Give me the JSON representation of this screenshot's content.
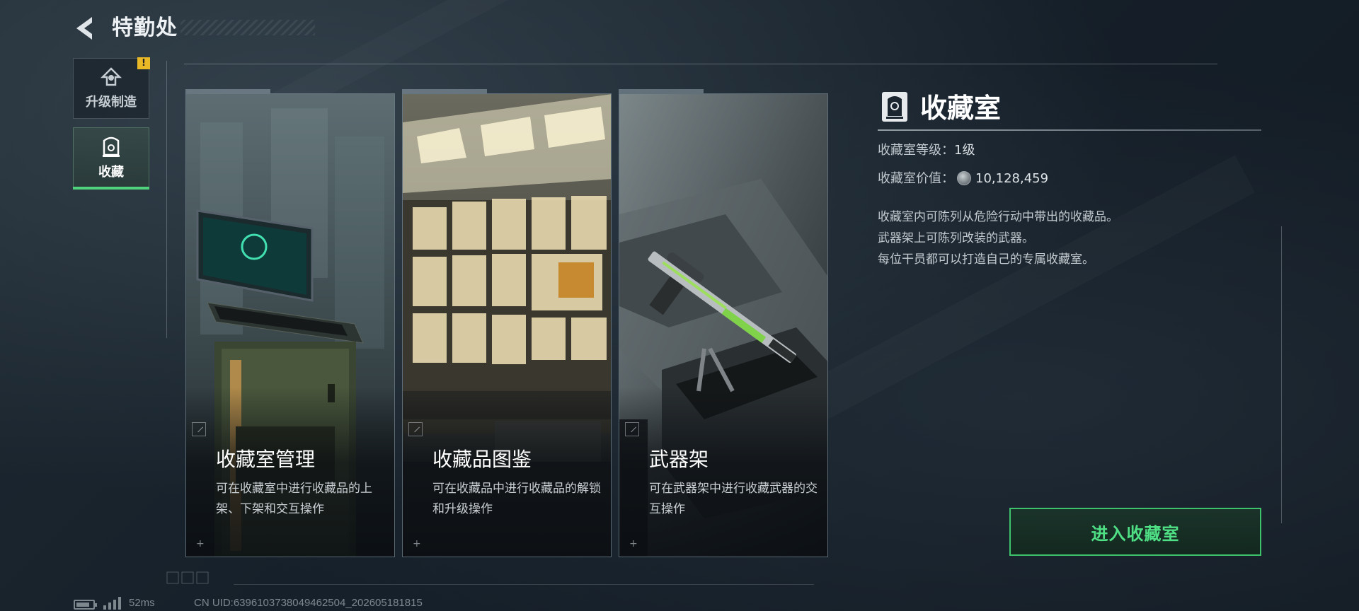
{
  "header": {
    "back_icon": "back-arrow-icon",
    "title": "特勤处"
  },
  "sidebar": {
    "items": [
      {
        "label": "升级制造",
        "icon": "upgrade-icon",
        "badge": "!"
      },
      {
        "label": "收藏",
        "icon": "collection-icon",
        "active": true
      }
    ]
  },
  "cards": [
    {
      "title": "收藏室管理",
      "desc": "可在收藏室中进行收藏品的上架、下架和交互操作"
    },
    {
      "title": "收藏品图鉴",
      "desc": "可在收藏品中进行收藏品的解锁和升级操作"
    },
    {
      "title": "武器架",
      "desc": "可在武器架中进行收藏武器的交互操作"
    }
  ],
  "panel": {
    "icon": "collection-room-icon",
    "title": "收藏室",
    "level_label": "收藏室等级：",
    "level_value": "1级",
    "value_label": "收藏室价值：",
    "value_amount": "10,128,459",
    "desc_lines": [
      "收藏室内可陈列从危险行动中带出的收藏品。",
      "武器架上可陈列改装的武器。",
      "每位干员都可以打造自己的专属收藏室。"
    ],
    "enter_button": "进入收藏室"
  },
  "status": {
    "ping": "52ms",
    "uid": "CN UID:6396103738049462504_202605181815"
  },
  "colors": {
    "accent_green": "#4fe085",
    "badge_yellow": "#e8b827",
    "background": "#16202a"
  }
}
